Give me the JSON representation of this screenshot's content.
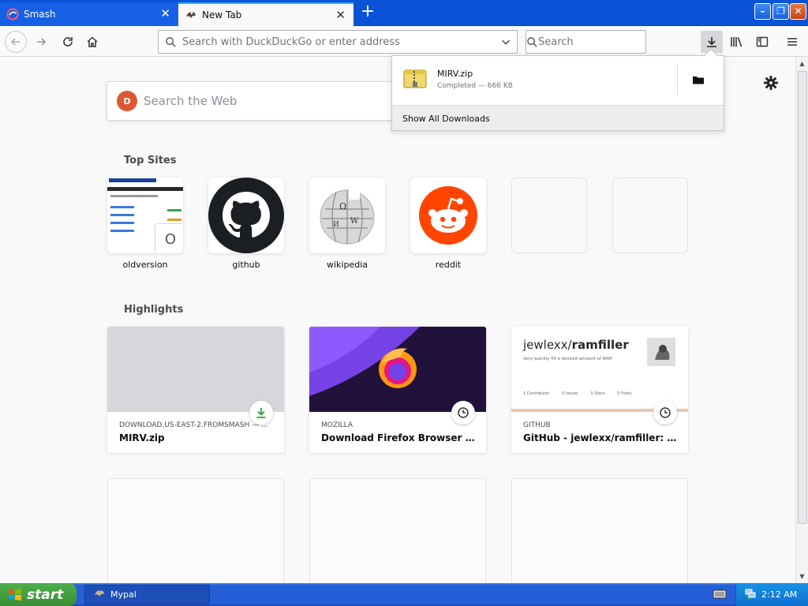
{
  "tabs": [
    {
      "label": "Smash",
      "icon": "smash-icon",
      "active": false
    },
    {
      "label": "New Tab",
      "icon": "mypal-icon",
      "active": true
    }
  ],
  "navbar": {
    "url_placeholder": "Search with DuckDuckGo or enter address",
    "search_placeholder": "Search"
  },
  "newtab": {
    "web_search_placeholder": "Search the Web",
    "top_sites_title": "Top Sites",
    "highlights_title": "Highlights",
    "top_sites": [
      {
        "label": "oldversion",
        "badge": "O"
      },
      {
        "label": "github"
      },
      {
        "label": "wikipedia"
      },
      {
        "label": "reddit"
      },
      {
        "label": ""
      },
      {
        "label": ""
      }
    ],
    "highlights": [
      {
        "source": "DOWNLOAD.US-EAST-2.FROMSMASH — ...",
        "title": "MIRV.zip",
        "badge": "download-icon"
      },
      {
        "source": "MOZILLA",
        "title": "Download Firefox Browser — Fa...",
        "badge": "clock-icon"
      },
      {
        "source": "GITHUB",
        "title": "GitHub - jewlexx/ramfiller: Very...",
        "badge": "clock-icon",
        "preview": {
          "owner": "jewlexx/",
          "repo": "ramfiller",
          "desc": "Very quickly fill a desired amount of RAM",
          "stats": [
            {
              "n": "1",
              "l": "Contributor"
            },
            {
              "n": "0",
              "l": "Issues"
            },
            {
              "n": "0",
              "l": "Stars"
            },
            {
              "n": "0",
              "l": "Forks"
            }
          ]
        }
      }
    ]
  },
  "downloads": {
    "file_name": "MIRV.zip",
    "status": "Completed — 666 KB",
    "show_all": "Show All Downloads"
  },
  "taskbar": {
    "start_label": "start",
    "task_label": "Mypal",
    "clock": "2:12 AM"
  },
  "colors": {
    "titlebar": "#0a53d6",
    "accent": "#2aaeff",
    "ddg": "#de5833",
    "reddit": "#ff4500",
    "download_green": "#2ba52b"
  }
}
